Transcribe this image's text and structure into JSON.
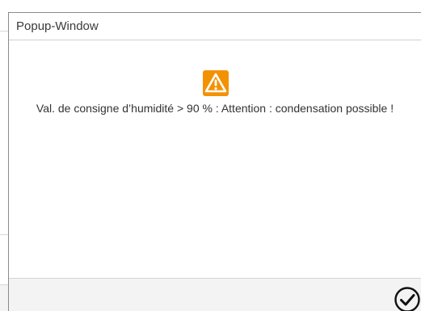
{
  "popup": {
    "title": "Popup-Window",
    "icon": "warning-triangle-icon",
    "icon_color": "#f39200",
    "message": "Val. de consigne d’humidité > 90 % : Attention : condensation possible !",
    "confirm_icon": "check-circle-icon"
  }
}
